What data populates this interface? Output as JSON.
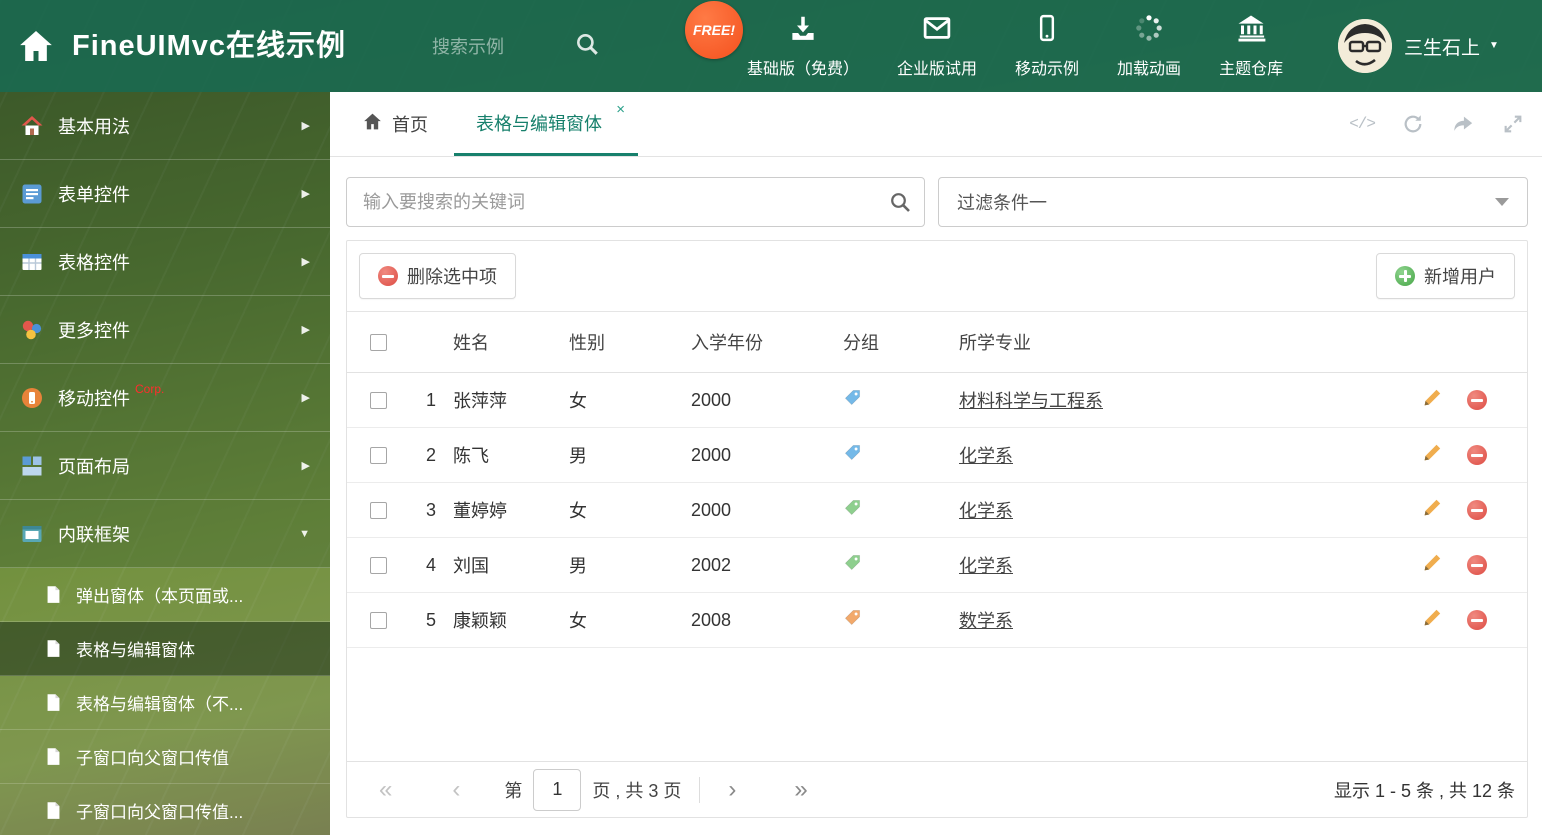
{
  "header": {
    "title": "FineUIMvc在线示例",
    "search_placeholder": "搜索示例",
    "free_badge": "FREE!",
    "nav": [
      {
        "label": "基础版（免费）"
      },
      {
        "label": "企业版试用"
      },
      {
        "label": "移动示例"
      },
      {
        "label": "加载动画"
      },
      {
        "label": "主题仓库"
      }
    ],
    "user_name": "三生石上"
  },
  "sidebar": {
    "items": [
      {
        "label": "基本用法"
      },
      {
        "label": "表单控件"
      },
      {
        "label": "表格控件"
      },
      {
        "label": "更多控件"
      },
      {
        "label": "移动控件",
        "badge": "Corp."
      },
      {
        "label": "页面布局"
      },
      {
        "label": "内联框架"
      }
    ],
    "subitems": [
      {
        "label": "弹出窗体（本页面或..."
      },
      {
        "label": "表格与编辑窗体"
      },
      {
        "label": "表格与编辑窗体（不..."
      },
      {
        "label": "子窗口向父窗口传值"
      },
      {
        "label": "子窗口向父窗口传值..."
      }
    ]
  },
  "tabs": {
    "home": "首页",
    "active": "表格与编辑窗体"
  },
  "filter": {
    "search_placeholder": "输入要搜索的关键词",
    "dropdown_value": "过滤条件一"
  },
  "toolbar": {
    "delete_label": "删除选中项",
    "add_label": "新增用户"
  },
  "grid": {
    "columns": [
      "姓名",
      "性别",
      "入学年份",
      "分组",
      "所学专业"
    ],
    "rows": [
      {
        "index": "1",
        "name": "张萍萍",
        "gender": "女",
        "year": "2000",
        "tag_color": "#74b9e8",
        "major": "材料科学与工程系"
      },
      {
        "index": "2",
        "name": "陈飞",
        "gender": "男",
        "year": "2000",
        "tag_color": "#74b9e8",
        "major": "化学系"
      },
      {
        "index": "3",
        "name": "董婷婷",
        "gender": "女",
        "year": "2000",
        "tag_color": "#8ecf8e",
        "major": "化学系"
      },
      {
        "index": "4",
        "name": "刘国",
        "gender": "男",
        "year": "2002",
        "tag_color": "#8ecf8e",
        "major": "化学系"
      },
      {
        "index": "5",
        "name": "康颖颖",
        "gender": "女",
        "year": "2008",
        "tag_color": "#f2a96b",
        "major": "数学系"
      }
    ]
  },
  "pager": {
    "prefix": "第",
    "page": "1",
    "suffix": "页 , 共 3 页",
    "summary": "显示 1 - 5 条 , 共 12 条"
  },
  "glyphs": {
    "code": "</>",
    "caret_down": "▼",
    "chevron_right": "▶",
    "close": "×",
    "page_first": "«",
    "page_prev": "‹",
    "page_next": "›",
    "page_last": "»"
  },
  "colors": {
    "accent": "#17806c",
    "danger": "#dd4b43",
    "success": "#46a546",
    "free_badge": "#f4511e"
  }
}
